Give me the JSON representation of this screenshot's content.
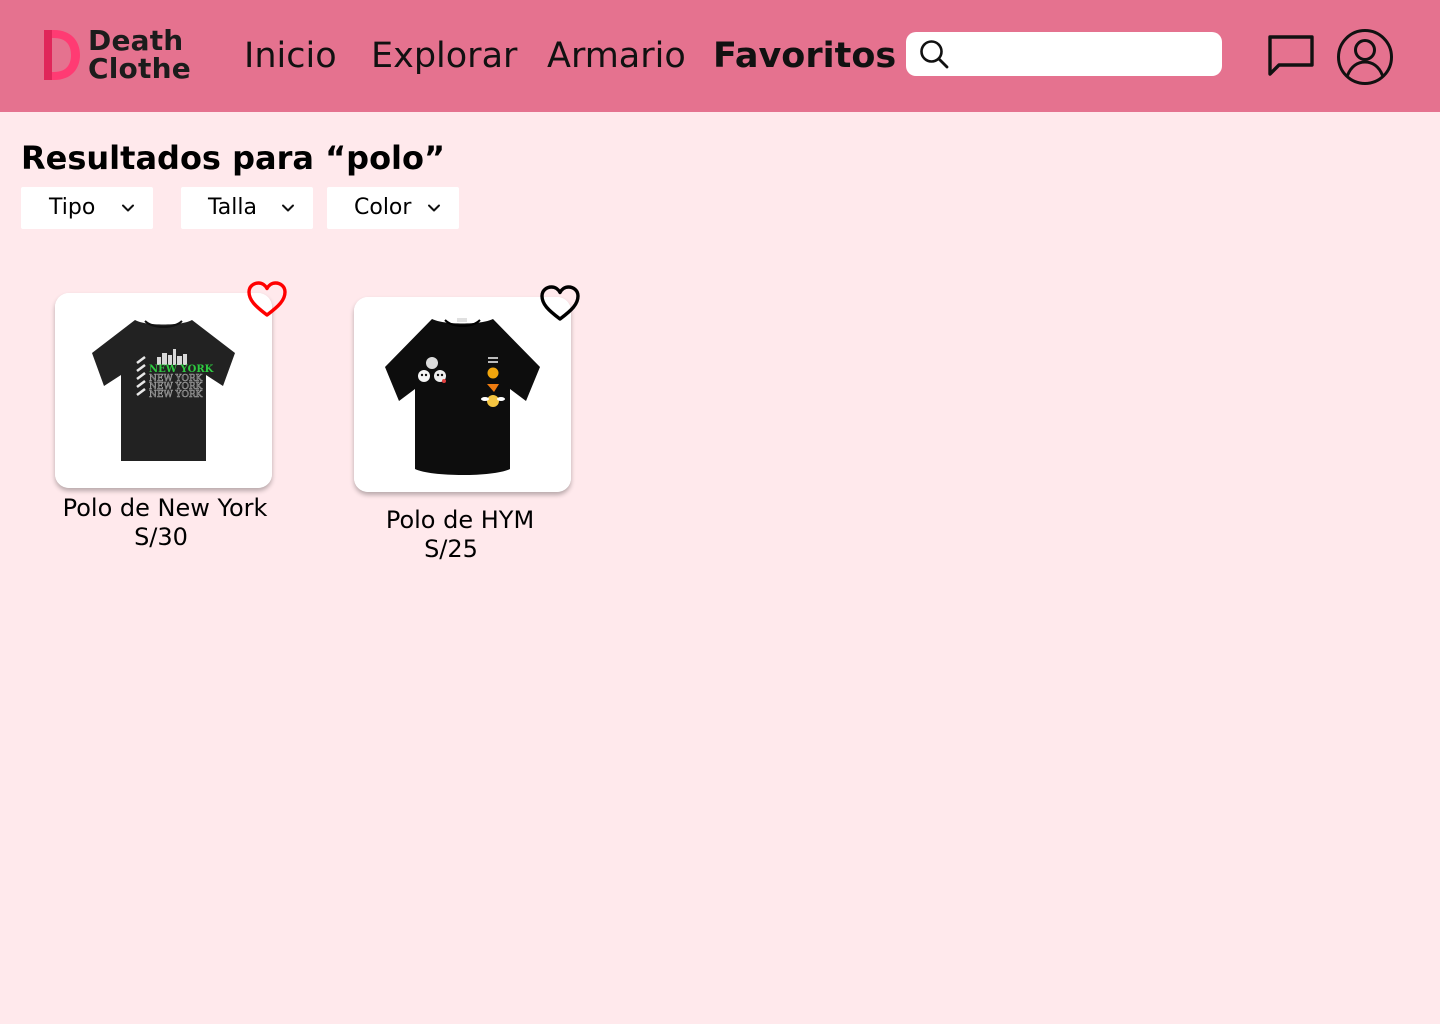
{
  "brand": {
    "line1": "Death",
    "line2": "Clothe",
    "logo_icon": "d-logo-icon",
    "accent_color": "#ff3b73"
  },
  "nav": {
    "items": [
      {
        "label": "Inicio",
        "active": false
      },
      {
        "label": "Explorar",
        "active": false
      },
      {
        "label": "Armario",
        "active": false
      },
      {
        "label": "Favoritos",
        "active": true
      }
    ]
  },
  "search": {
    "value": "",
    "placeholder": "",
    "icon": "search-icon"
  },
  "header_icons": {
    "messages": "chat-icon",
    "profile": "user-icon"
  },
  "results": {
    "title": "Resultados para “polo”"
  },
  "filters": [
    {
      "label": "Tipo"
    },
    {
      "label": "Talla"
    },
    {
      "label": "Color"
    }
  ],
  "products": [
    {
      "name": "Polo de New York",
      "price": "S/30",
      "favorited": true,
      "image": "black-tshirt-new-york-print"
    },
    {
      "name": "Polo de HYM",
      "price": "S/25",
      "favorited": false,
      "image": "black-tshirt-emoji-patches"
    }
  ],
  "colors": {
    "header_bg": "#e5728f",
    "page_bg": "#ffe9ec",
    "favorite_heart": "#ff0000"
  }
}
